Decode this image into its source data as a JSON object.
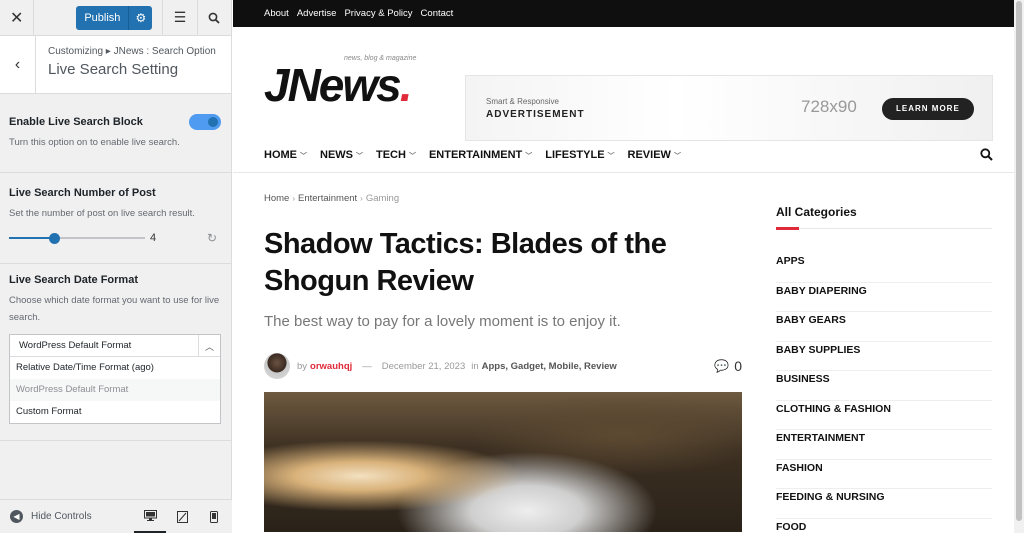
{
  "customizer": {
    "publish_label": "Publish",
    "breadcrumb": "Customizing ▸ JNews : Search Option",
    "section_title": "Live Search Setting",
    "controls": {
      "enable": {
        "title": "Enable Live Search Block",
        "desc": "Turn this option on to enable live search.",
        "enabled": true
      },
      "number": {
        "title": "Live Search Number of Post",
        "desc": "Set the number of post on live search result.",
        "value": "4",
        "fraction": 0.33
      },
      "date": {
        "title": "Live Search Date Format",
        "desc": "Choose which date format you want to use for live search.",
        "selected": "WordPress Default Format",
        "options": [
          "Relative Date/Time Format (ago)",
          "WordPress Default Format",
          "Custom Format"
        ]
      }
    },
    "hide_controls": "Hide Controls"
  },
  "site": {
    "topnav": [
      "About",
      "Advertise",
      "Privacy & Policy",
      "Contact"
    ],
    "logo": {
      "tagline": "news, blog & magazine",
      "name": "JNews",
      "dot": "."
    },
    "ad": {
      "small": "Smart & Responsive",
      "big": "ADVERTISEMENT",
      "size": "728x90",
      "button": "LEARN MORE"
    },
    "menu": [
      "HOME",
      "NEWS",
      "TECH",
      "ENTERTAINMENT",
      "LIFESTYLE",
      "REVIEW"
    ],
    "breadcrumb": [
      "Home",
      "Entertainment",
      "Gaming"
    ],
    "title": "Shadow Tactics: Blades of the Shogun Review",
    "subtitle": "The best way to pay for a lovely moment is to enjoy it.",
    "meta": {
      "by": "by",
      "author": "orwauhqj",
      "dash": "—",
      "date": "December 21, 2023",
      "in": "in",
      "categories": "Apps, Gadget, Mobile, Review",
      "comments": "0"
    },
    "sidebar": {
      "title": "All Categories",
      "categories": [
        "APPS",
        "BABY DIAPERING",
        "BABY GEARS",
        "BABY SUPPLIES",
        "BUSINESS",
        "CLOTHING & FASHION",
        "ENTERTAINMENT",
        "FASHION",
        "FEEDING & NURSING",
        "FOOD"
      ]
    }
  },
  "colors": {
    "accent": "#e02a3a",
    "wp_blue": "#2271b1",
    "toggle": "#4e9bf1"
  }
}
